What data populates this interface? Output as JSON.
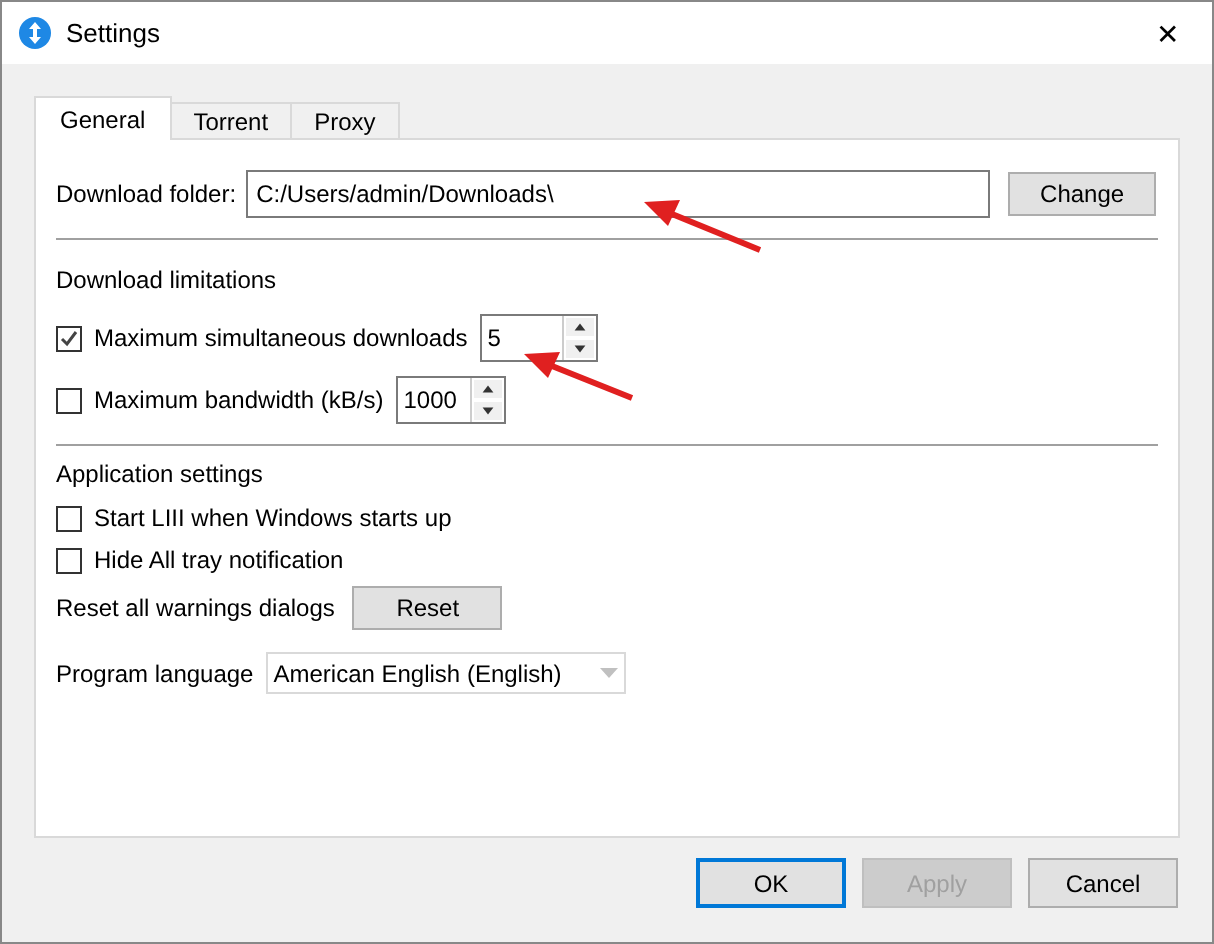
{
  "window": {
    "title": "Settings",
    "close": "✕"
  },
  "tabs": [
    {
      "label": "General",
      "selected": true
    },
    {
      "label": "Torrent",
      "selected": false
    },
    {
      "label": "Proxy",
      "selected": false
    }
  ],
  "download_folder": {
    "label": "Download folder:",
    "value": "C:/Users/admin/Downloads\\",
    "button": "Change"
  },
  "download_limitations": {
    "heading": "Download limitations",
    "rows": [
      {
        "label": "Maximum simultaneous downloads",
        "checked": true,
        "value": "5"
      },
      {
        "label": "Maximum bandwidth (kB/s)",
        "checked": false,
        "value": "1000"
      }
    ]
  },
  "application_settings": {
    "heading": "Application settings",
    "options": [
      {
        "label": "Start LIII when Windows starts up",
        "checked": false
      },
      {
        "label": "Hide All tray notification",
        "checked": false
      }
    ],
    "reset_label": "Reset all warnings dialogs",
    "reset_button": "Reset",
    "language_label": "Program language",
    "language_value": "American English (English)"
  },
  "buttons": [
    {
      "label": "OK",
      "disabled": false,
      "focused": true
    },
    {
      "label": "Apply",
      "disabled": true,
      "focused": false
    },
    {
      "label": "Cancel",
      "disabled": false,
      "focused": false
    }
  ]
}
